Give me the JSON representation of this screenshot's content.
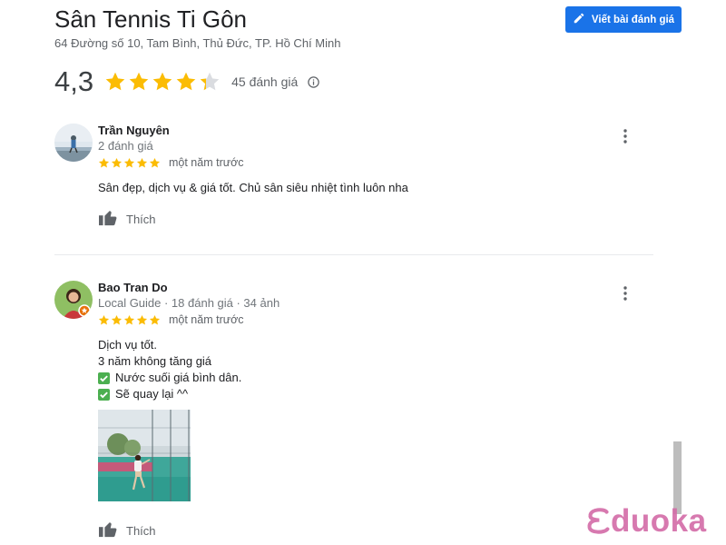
{
  "place": {
    "name": "Sân Tennis Ti Gôn",
    "address": "64 Đường số 10, Tam Bình, Thủ Đức, TP. Hồ Chí Minh"
  },
  "write_review": {
    "label": "Viết bài đánh giá",
    "icon": "pencil-icon"
  },
  "summary": {
    "rating": "4,3",
    "stars": 4.3,
    "count_label": "45 đánh giá",
    "info_icon": "info-icon"
  },
  "reviews": [
    {
      "name": "Trần Nguyên",
      "meta": "2 đánh giá",
      "stars": 5,
      "time": "một năm trước",
      "text": [
        "Sân đẹp, dịch vụ & giá tốt. Chủ sân siêu nhiệt tình luôn nha"
      ],
      "like_label": "Thích"
    },
    {
      "name": "Bao Tran Do",
      "meta": "Local Guide · 18 đánh giá · 34 ảnh",
      "stars": 5,
      "time": "một năm trước",
      "text": [
        "Dịch vụ tốt.",
        "3 năm không tăng giá",
        "Nước suối giá bình dân.",
        "Sẽ quay lại ^^"
      ],
      "like_label": "Thích"
    }
  ],
  "watermark": {
    "text": "duoka",
    "brand_color": "#d36ba7"
  },
  "colors": {
    "accent": "#1a73e8",
    "star": "#fbbc04",
    "check": "#4caf50"
  }
}
